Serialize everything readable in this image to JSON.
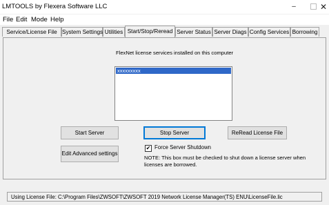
{
  "window": {
    "title": "LMTOOLS by Flexera Software LLC",
    "minimize": "–",
    "close": "✕"
  },
  "menu": {
    "items": [
      "File",
      "Edit",
      "Mode",
      "Help"
    ]
  },
  "tabs": [
    {
      "label": "Service/License File",
      "active": false
    },
    {
      "label": "System Settings",
      "active": false
    },
    {
      "label": "Utilities",
      "active": false
    },
    {
      "label": "Start/Stop/Reread",
      "active": true
    },
    {
      "label": "Server Status",
      "active": false
    },
    {
      "label": "Server Diags",
      "active": false
    },
    {
      "label": "Config Services",
      "active": false
    },
    {
      "label": "Borrowing",
      "active": false
    }
  ],
  "main": {
    "caption": "FlexNet license services installed on this computer",
    "list_items": [
      "xxxxxxxxx"
    ],
    "start_server": "Start Server",
    "stop_server": "Stop Server",
    "reread": "ReRead License File",
    "edit_advanced": "Edit Advanced settings",
    "force_shutdown": {
      "label": "Force Server Shutdown",
      "checked": true,
      "mark": "✔"
    },
    "note": "NOTE:  This box must be checked to shut down a license server when licenses are borrowed."
  },
  "status": {
    "text": "Using License File:  C:\\Program Files\\ZWSOFT\\ZWSOFT 2019 Network License Manager(TS) ENU\\LicenseFile.lic"
  }
}
